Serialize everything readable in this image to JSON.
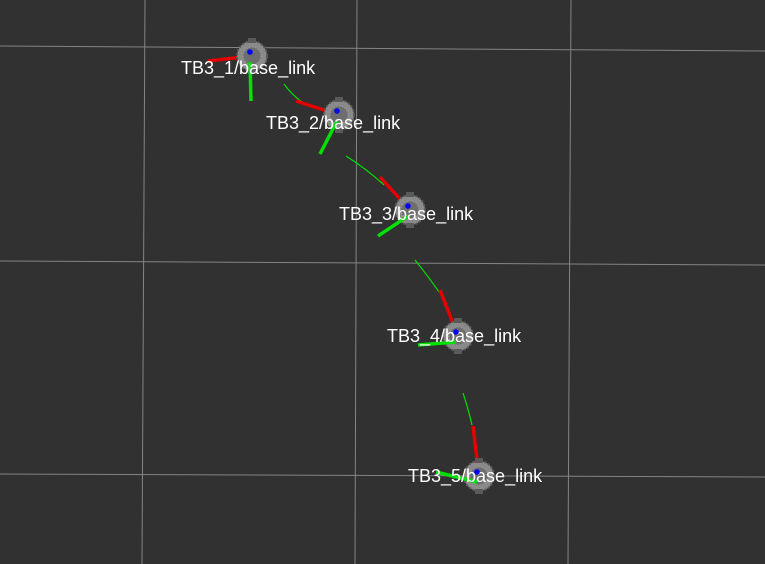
{
  "scene": {
    "background_color": "#313131",
    "grid_color": "#a0a0a0",
    "path_color": "#00dd00",
    "x_axis_color": "#e00000",
    "y_axis_color": "#00e000",
    "z_axis_color": "#0000ff",
    "robot_color": "#8a8a8a"
  },
  "robots": [
    {
      "label": "TB3_1/base_link"
    },
    {
      "label": "TB3_2/base_link"
    },
    {
      "label": "TB3_3/base_link"
    },
    {
      "label": "TB3_4/base_link"
    },
    {
      "label": "TB3_5/base_link"
    }
  ]
}
